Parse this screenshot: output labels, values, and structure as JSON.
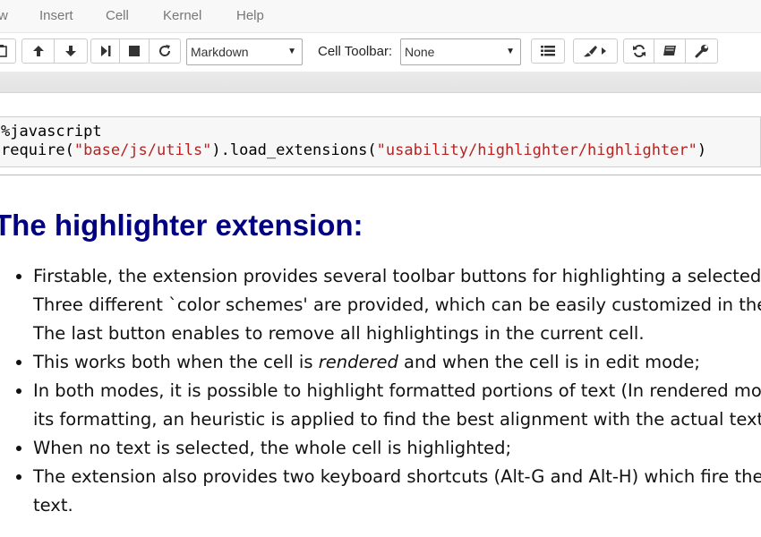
{
  "menubar": {
    "items": [
      "w",
      "Insert",
      "Cell",
      "Kernel",
      "Help"
    ]
  },
  "toolbar": {
    "cell_type_value": "Markdown",
    "cell_toolbar_label": "Cell Toolbar:",
    "cell_toolbar_value": "None"
  },
  "code_cell": {
    "line1": "%javascript",
    "line2_prefix": "require(",
    "line2_str1": "\"base/js/utils\"",
    "line2_mid": ").load_extensions(",
    "line2_str2": "\"usability/highlighter/highlighter\"",
    "line2_suffix": ")"
  },
  "markdown": {
    "heading": "The highlighter extension:",
    "bullets": [
      "Firstable, the extension provides several toolbar buttons for highlighting a selected tex",
      "Three different `color schemes' are provided, which can be easily customized in the s",
      "The last button enables to remove all highlightings in the current cell.",
      "This works both when the cell is ",
      "rendered",
      " and when the cell is in edit mode;",
      "In both modes, it is possible to highlight formatted portions of text (In rendered mode",
      "its formatting, an heuristic is applied to find the best alignment with the actual text)",
      "When no text is selected, the whole cell is highlighted;",
      "The extension also provides two keyboard shortcuts (Alt-G and Alt-H) which fire the",
      "text."
    ]
  }
}
